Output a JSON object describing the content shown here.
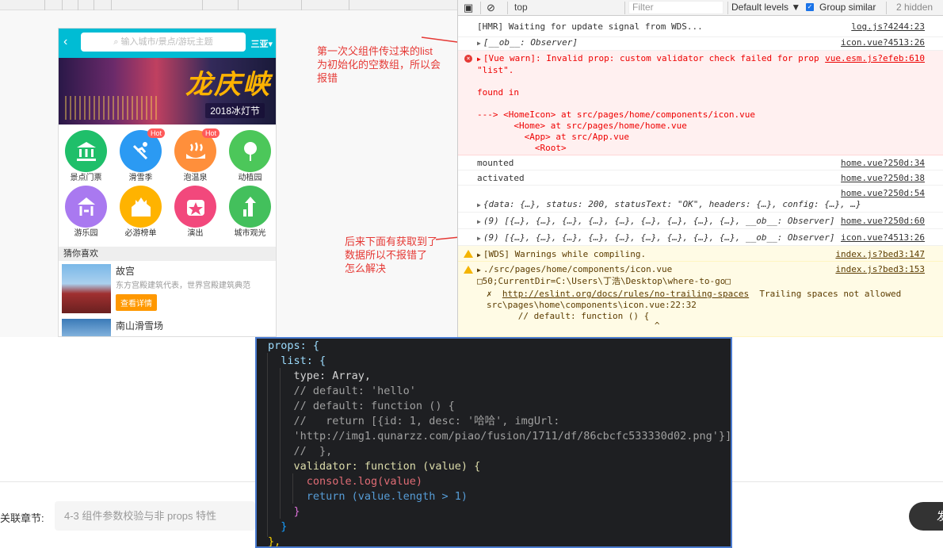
{
  "phone": {
    "search_placeholder": "输入城市/景点/游玩主题",
    "city": "三亚",
    "banner_title": "龙庆峡",
    "banner_subtitle": "2018冰灯节",
    "icons": [
      {
        "label": "景点门票",
        "color": "#1fbf6a",
        "hot": ""
      },
      {
        "label": "滑雪季",
        "color": "#2b9af3",
        "hot": "Hot"
      },
      {
        "label": "泡温泉",
        "color": "#ff8f3b",
        "hot": "Hot"
      },
      {
        "label": "动植园",
        "color": "#4cc75a",
        "hot": ""
      },
      {
        "label": "游乐园",
        "color": "#a979f0",
        "hot": ""
      },
      {
        "label": "必游榜单",
        "color": "#ffb300",
        "hot": ""
      },
      {
        "label": "演出",
        "color": "#f2487c",
        "hot": ""
      },
      {
        "label": "城市观光",
        "color": "#43c05c",
        "hot": ""
      }
    ],
    "guess_title": "猜你喜欢",
    "recommend": [
      {
        "title": "故宫",
        "desc": "东方宫殿建筑代表，世界宫殿建筑典范",
        "button": "查看详情"
      },
      {
        "title": "南山滑雪场",
        "desc": "",
        "button": ""
      }
    ]
  },
  "annotations": {
    "note1": [
      "第一次父组件传过来的list",
      "为初始化的空数组，所以会",
      "报错"
    ],
    "note2": [
      "后来下面有获取到了",
      "数据所以不报错了",
      "怎么解决"
    ],
    "color": "#e53935"
  },
  "devtools": {
    "context": "top",
    "filter_placeholder": "Filter",
    "levels": "Default levels ▼",
    "group_similar": "Group similar",
    "hidden": "2 hidden",
    "logs": [
      {
        "text": "[HMR] Waiting for update signal from WDS...",
        "src": "log.js?4244:23"
      },
      {
        "text": "[__ob__: Observer]",
        "src": "icon.vue?4513:26"
      },
      {
        "text": "[Vue warn]: Invalid prop: custom validator check failed for prop",
        "src": "vue.esm.js?efeb:610"
      },
      {
        "text": "\"list\"."
      },
      {
        "text": "found in"
      },
      {
        "text": "---> <HomeIcon> at src/pages/home/components/icon.vue"
      },
      {
        "text": "       <Home> at src/pages/home/home.vue"
      },
      {
        "text": "         <App> at src/App.vue"
      },
      {
        "text": "           <Root>"
      },
      {
        "text": "mounted",
        "src": "home.vue?250d:34"
      },
      {
        "text": "activated",
        "src": "home.vue?250d:38"
      },
      {
        "text": "",
        "src": "home.vue?250d:54"
      },
      {
        "text": "{data: {…}, status: 200, statusText: \"OK\", headers: {…}, config: {…}, …}"
      },
      {
        "text": "(9) [{…}, {…}, {…}, {…}, {…}, {…}, {…}, {…}, {…}, __ob__: Observer]",
        "src": "home.vue?250d:60"
      },
      {
        "text": "(9) [{…}, {…}, {…}, {…}, {…}, {…}, {…}, {…}, {…}, __ob__: Observer]",
        "src": "icon.vue?4513:26"
      },
      {
        "text": "[WDS] Warnings while compiling.",
        "src": "index.js?bed3:147"
      },
      {
        "text": "./src/pages/home/components/icon.vue",
        "src": "index.js?bed3:153"
      },
      {
        "text": "□50;CurrentDir=C:\\Users\\丁浩\\Desktop\\where-to-go□"
      },
      {
        "text": "http://eslint.org/docs/rules/no-trailing-spaces",
        "extra": "  Trailing spaces not allowed"
      },
      {
        "text": "src\\pages\\home\\components\\icon.vue:22:32"
      },
      {
        "text": "      // default: function () {"
      },
      {
        "text": "                                ^"
      }
    ]
  },
  "code": {
    "lines": [
      "props: {",
      "  list: {",
      "    type: Array,",
      "    // default: 'hello'",
      "    // default: function () {",
      "    //   return [{id: 1, desc: '哈哈', imgUrl:",
      "    'http://img1.qunarzz.com/piao/fusion/1711/df/86cbcfc533330d02.png'}]",
      "    //  },",
      "    validator: function (value) {",
      "      console.log(value)",
      "      return (value.length > 1)",
      "    }",
      "  }",
      "},"
    ]
  },
  "bottom": {
    "chapter_label": "关联章节:",
    "chapter_value": "4-3 组件参数校验与非 props 特性",
    "publish": "发"
  }
}
